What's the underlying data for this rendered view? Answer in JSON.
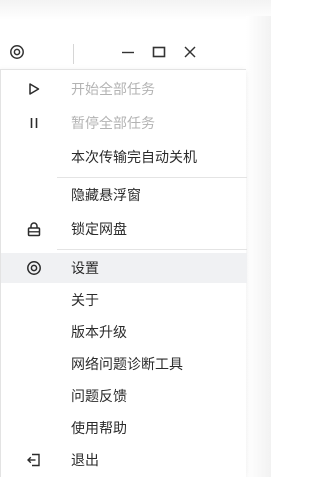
{
  "menu": {
    "items": [
      {
        "label": "开始全部任务",
        "icon": "play-icon",
        "disabled": true
      },
      {
        "label": "暂停全部任务",
        "icon": "pause-icon",
        "disabled": true
      },
      {
        "label": "本次传输完自动关机",
        "icon": "",
        "disabled": false
      },
      {
        "label": "隐藏悬浮窗",
        "icon": "",
        "disabled": false
      },
      {
        "label": "锁定网盘",
        "icon": "lock-icon",
        "disabled": false
      },
      {
        "label": "设置",
        "icon": "settings-icon",
        "disabled": false,
        "active": true
      },
      {
        "label": "关于",
        "icon": "",
        "disabled": false
      },
      {
        "label": "版本升级",
        "icon": "",
        "disabled": false
      },
      {
        "label": "网络问题诊断工具",
        "icon": "",
        "disabled": false
      },
      {
        "label": "问题反馈",
        "icon": "",
        "disabled": false
      },
      {
        "label": "使用帮助",
        "icon": "",
        "disabled": false
      },
      {
        "label": "退出",
        "icon": "exit-icon",
        "disabled": false
      }
    ]
  },
  "colors": {
    "text": "#2b2b2b",
    "disabled_text": "#b3b3b3",
    "hover_bg": "#f0f1f3",
    "separator": "#e4e4e4"
  }
}
